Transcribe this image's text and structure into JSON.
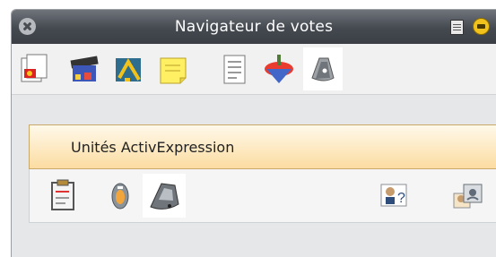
{
  "window": {
    "title": "Navigateur de votes"
  },
  "titlebar_buttons": {
    "close_icon": "close-circle-icon",
    "menu_icon": "window-menu-icon",
    "pin_icon": "pin-icon"
  },
  "toolbar": {
    "items": [
      {
        "icon": "pages-icon"
      },
      {
        "icon": "resources-icon"
      },
      {
        "icon": "annotations-icon"
      },
      {
        "icon": "notes-icon"
      },
      {
        "icon": "properties-icon"
      },
      {
        "icon": "spinning-top-icon"
      },
      {
        "icon": "voting-device-icon",
        "selected": true
      }
    ]
  },
  "panel": {
    "title": "Unités ActivExpression",
    "items": [
      {
        "icon": "clipboard-icon"
      },
      {
        "icon": "activote-device-icon"
      },
      {
        "icon": "activexpression-device-icon",
        "selected": true
      },
      {
        "icon": "unknown-learner-icon"
      },
      {
        "icon": "learner-registration-icon"
      }
    ]
  },
  "colors": {
    "titlebar": "#3f4349",
    "panel_header": "#fde4b2",
    "accent": "#f1c21b"
  }
}
